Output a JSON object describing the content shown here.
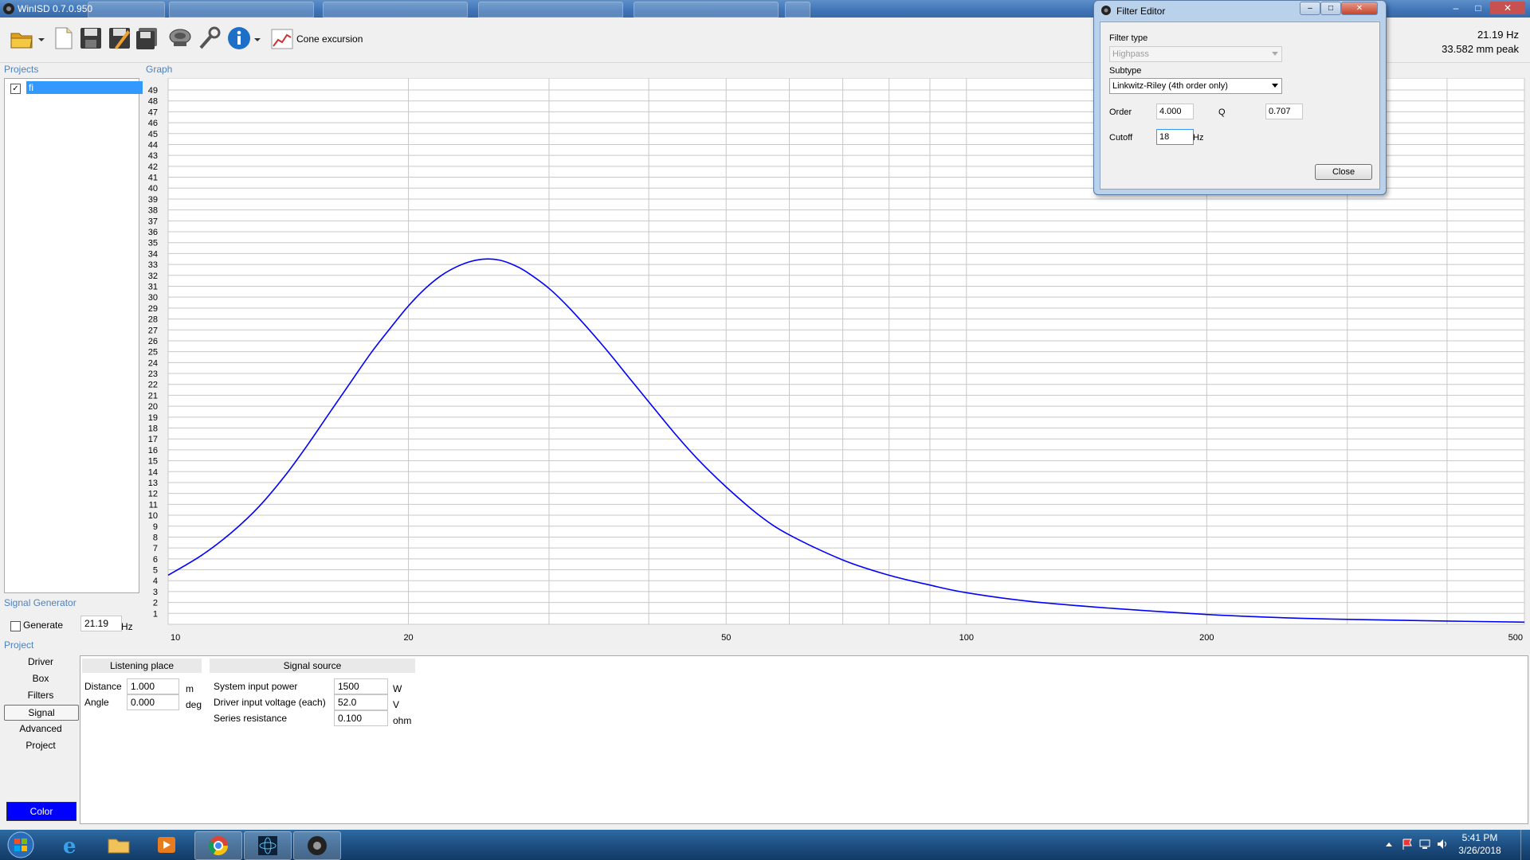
{
  "window": {
    "title": "WinISD 0.7.0.950"
  },
  "toolbar": {
    "cone_label": "Cone excursion"
  },
  "readout": {
    "freq": "21.19 Hz",
    "peak": "33.582 mm peak"
  },
  "sections": {
    "projects": "Projects",
    "graph": "Graph",
    "signal_generator": "Signal Generator",
    "project": "Project"
  },
  "projects": {
    "items": [
      {
        "name": "fi",
        "checked": true
      }
    ]
  },
  "signal_generator": {
    "generate_label": "Generate",
    "frequency": "21.19",
    "unit": "Hz"
  },
  "nav": {
    "items": [
      "Driver",
      "Box",
      "Filters",
      "Signal",
      "Advanced",
      "Project"
    ],
    "selected": "Signal",
    "color_button": "Color"
  },
  "listening_place": {
    "header": "Listening place",
    "distance": {
      "label": "Distance",
      "value": "1.000",
      "unit": "m"
    },
    "angle": {
      "label": "Angle",
      "value": "0.000",
      "unit": "deg"
    }
  },
  "signal_source": {
    "header": "Signal source",
    "power": {
      "label": "System input power",
      "value": "1500",
      "unit": "W"
    },
    "voltage": {
      "label": "Driver input voltage (each)",
      "value": "52.0",
      "unit": "V"
    },
    "resistance": {
      "label": "Series resistance",
      "value": "0.100",
      "unit": "ohm"
    }
  },
  "filter_editor": {
    "title": "Filter Editor",
    "filter_type_label": "Filter type",
    "filter_type": "Highpass",
    "subtype_label": "Subtype",
    "subtype": "Linkwitz-Riley (4th order only)",
    "order_label": "Order",
    "order": "4.000",
    "q_label": "Q",
    "q": "0.707",
    "cutoff_label": "Cutoff",
    "cutoff": "18",
    "cutoff_unit": "Hz",
    "close_label": "Close"
  },
  "taskbar": {
    "time": "5:41 PM",
    "date": "3/26/2018"
  },
  "colors": {
    "curve": "#0000ff",
    "accent": "#4f81bd",
    "selection": "#3399ff"
  },
  "chart_data": {
    "type": "line",
    "x_scale": "log",
    "xlim": [
      10,
      500
    ],
    "ylim": [
      0,
      49
    ],
    "x_tick_labels": [
      "10",
      "20",
      "50",
      "100",
      "200",
      "500"
    ],
    "y_tick_labels": [
      "1",
      "2",
      "3",
      "4",
      "5",
      "6",
      "7",
      "8",
      "9",
      "10",
      "11",
      "12",
      "13",
      "14",
      "15",
      "16",
      "17",
      "18",
      "19",
      "20",
      "21",
      "22",
      "23",
      "24",
      "25",
      "26",
      "27",
      "28",
      "29",
      "30",
      "31",
      "32",
      "33",
      "34",
      "35",
      "36",
      "37",
      "38",
      "39",
      "40",
      "41",
      "42",
      "43",
      "44",
      "45",
      "46",
      "47",
      "48",
      "49"
    ],
    "grid": true,
    "series": [
      {
        "color": "#0000ff",
        "x": [
          10,
          11,
          12,
          13,
          14,
          15,
          16,
          17,
          18,
          19,
          20,
          21,
          22,
          23,
          24,
          25,
          26,
          27,
          28,
          30,
          32,
          35,
          38,
          40,
          43,
          46,
          50,
          55,
          60,
          70,
          80,
          90,
          100,
          120,
          150,
          200,
          250,
          300,
          400,
          500
        ],
        "y": [
          4.5,
          6.3,
          8.4,
          10.8,
          13.6,
          16.6,
          19.6,
          22.4,
          25.0,
          27.2,
          29.2,
          30.8,
          32.0,
          32.8,
          33.3,
          33.5,
          33.4,
          33.0,
          32.4,
          30.8,
          28.8,
          25.6,
          22.4,
          20.4,
          17.6,
          15.2,
          12.6,
          10.0,
          8.2,
          5.9,
          4.5,
          3.6,
          2.9,
          2.1,
          1.5,
          0.9,
          0.6,
          0.45,
          0.3,
          0.2
        ]
      }
    ]
  }
}
